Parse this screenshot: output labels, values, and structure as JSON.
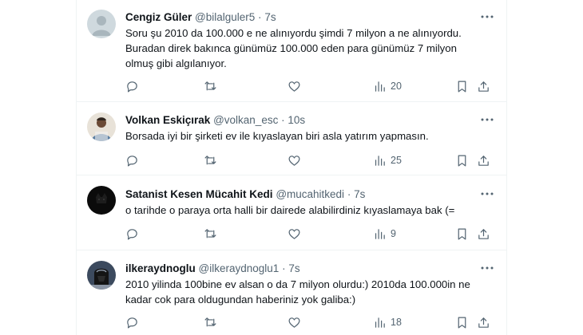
{
  "tweets": [
    {
      "name": "Cengiz Güler",
      "handle": "@bilalguler5",
      "sep": "·",
      "time": "7s",
      "lines": [
        "Soru şu 2010 da 100.000 e ne alınıyordu şimdi 7 milyon a ne alınıyordu.",
        "Buradan direk bakınca günümüz 100.000 eden para günümüz 7 milyon",
        "olmuş gibi algılanıyor."
      ],
      "views": "20",
      "avatar": "default-avatar"
    },
    {
      "name": "Volkan Eskiçırak",
      "handle": "@volkan_esc",
      "sep": "·",
      "time": "10s",
      "lines": [
        "Borsada iyi bir şirketi ev ile kıyaslayan biri asla yatırım yapmasın."
      ],
      "views": "25",
      "avatar": "photo-avatar"
    },
    {
      "name": "Satanist Kesen Mücahit Kedi",
      "handle": "@mucahitkedi",
      "sep": "·",
      "time": "7s",
      "lines": [
        "o tarihde o paraya orta halli bir dairede alabilirdiniz kıyaslamaya bak (="
      ],
      "views": "9",
      "avatar": "dark-avatar"
    },
    {
      "name": "ilkeraydnoglu",
      "handle": "@ilkeraydnoglu1",
      "sep": "·",
      "time": "7s",
      "lines": [
        "2010 yilinda 100bine ev alsan o da 7 milyon olurdu:) 2010da 100.000in ne",
        "kadar cok para oldugundan haberiniz yok galiba:)"
      ],
      "views": "18",
      "avatar": "helmet-avatar"
    }
  ],
  "colors": {
    "text": "#0f1419",
    "secondary": "#536471",
    "border": "#eff3f4"
  }
}
